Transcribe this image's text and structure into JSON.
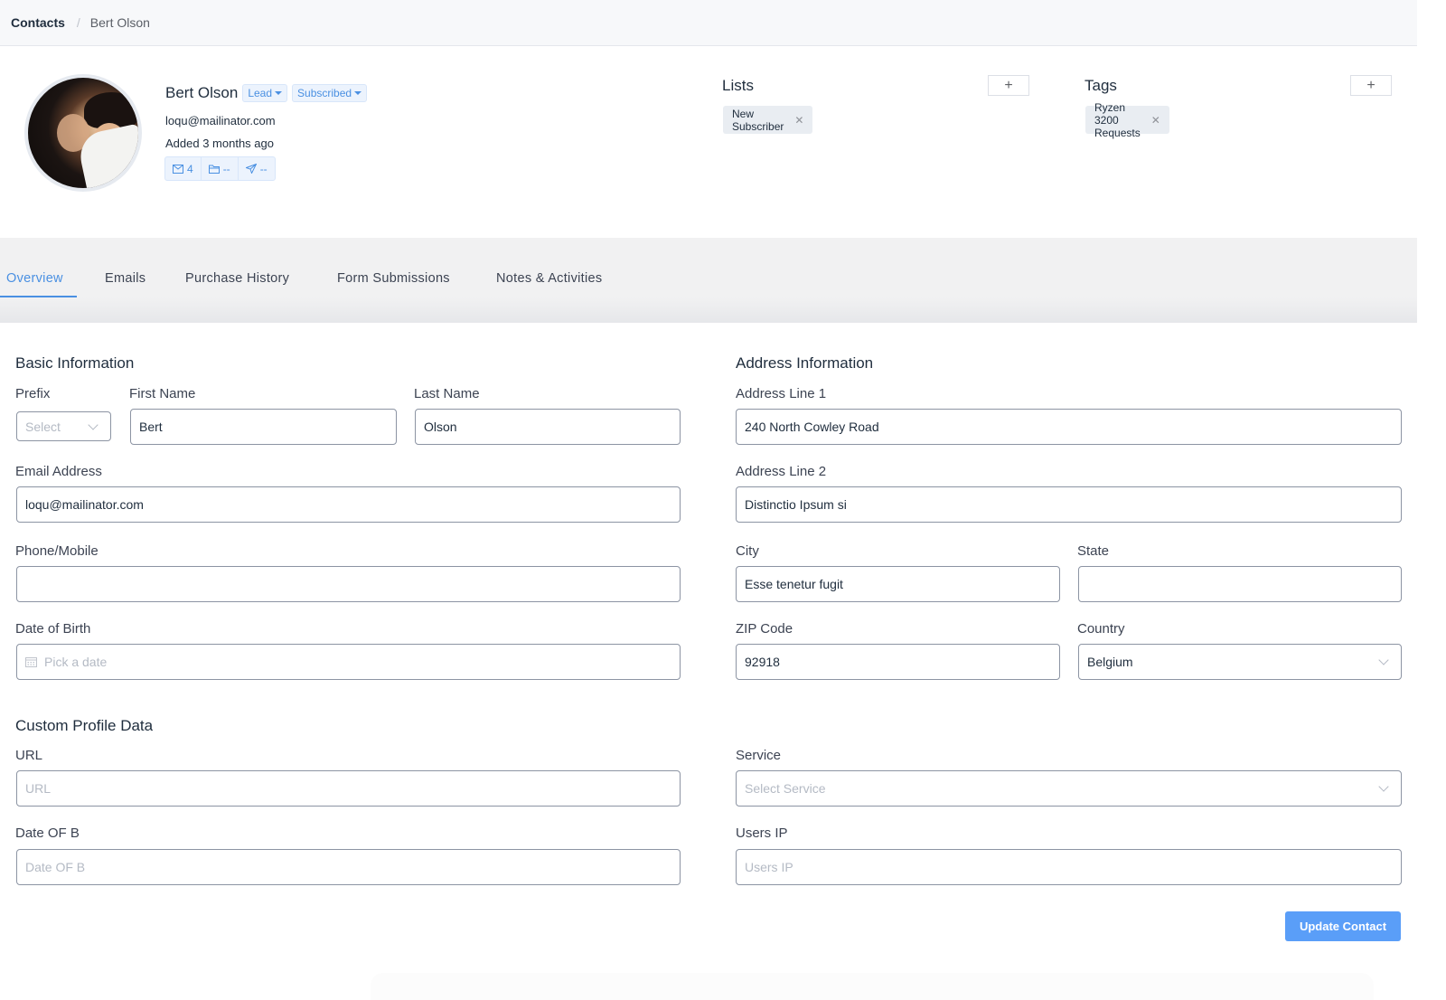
{
  "breadcrumb": {
    "root": "Contacts",
    "separator": "/",
    "current": "Bert Olson"
  },
  "profile": {
    "name": "Bert Olson",
    "status_dropdown": "Lead",
    "subscription_dropdown": "Subscribed",
    "email": "loqu@mailinator.com",
    "added": "Added 3 months ago",
    "stats": [
      {
        "icon": "mail-icon",
        "value": "4"
      },
      {
        "icon": "folder-icon",
        "value": "--"
      },
      {
        "icon": "send-icon",
        "value": "--"
      }
    ]
  },
  "lists": {
    "title": "Lists",
    "add_label": "+",
    "items": [
      "New Subscriber"
    ]
  },
  "tags": {
    "title": "Tags",
    "add_label": "+",
    "items": [
      "Ryzen 3200 Requests"
    ]
  },
  "tabs": [
    {
      "label": "Overview",
      "active": true
    },
    {
      "label": "Emails",
      "active": false
    },
    {
      "label": "Purchase History",
      "active": false
    },
    {
      "label": "Form Submissions",
      "active": false
    },
    {
      "label": "Notes & Activities",
      "active": false
    }
  ],
  "basic": {
    "title": "Basic Information",
    "prefix": {
      "label": "Prefix",
      "value": "",
      "placeholder": "Select"
    },
    "first_name": {
      "label": "First Name",
      "value": "Bert"
    },
    "last_name": {
      "label": "Last Name",
      "value": "Olson"
    },
    "email": {
      "label": "Email Address",
      "value": "loqu@mailinator.com"
    },
    "phone": {
      "label": "Phone/Mobile",
      "value": ""
    },
    "dob": {
      "label": "Date of Birth",
      "value": "",
      "placeholder": "Pick a date"
    }
  },
  "address": {
    "title": "Address Information",
    "line1": {
      "label": "Address Line 1",
      "value": "240 North Cowley Road"
    },
    "line2": {
      "label": "Address Line 2",
      "value": "Distinctio Ipsum si"
    },
    "city": {
      "label": "City",
      "value": "Esse tenetur fugit"
    },
    "state": {
      "label": "State",
      "value": ""
    },
    "zip": {
      "label": "ZIP Code",
      "value": "92918"
    },
    "country": {
      "label": "Country",
      "value": "Belgium"
    }
  },
  "custom": {
    "title": "Custom Profile Data",
    "url": {
      "label": "URL",
      "value": "",
      "placeholder": "URL"
    },
    "date_of_b": {
      "label": "Date OF B",
      "value": "",
      "placeholder": "Date OF B"
    },
    "service": {
      "label": "Service",
      "value": "",
      "placeholder": "Select Service"
    },
    "users_ip": {
      "label": "Users IP",
      "value": "",
      "placeholder": "Users IP"
    }
  },
  "actions": {
    "update_label": "Update Contact"
  },
  "colors": {
    "accent": "#4a90e2",
    "button": "#5a9ef8",
    "chip_bg": "#e9edf2"
  }
}
